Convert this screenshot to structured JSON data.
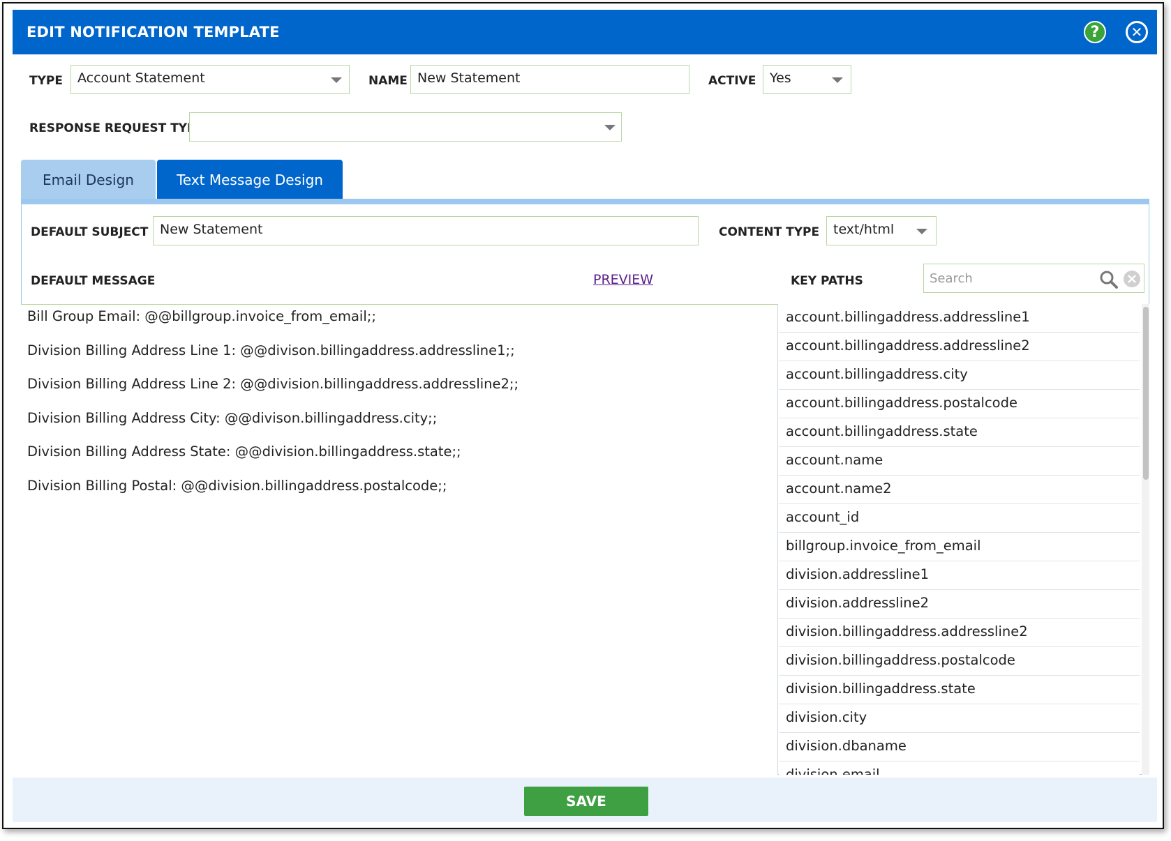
{
  "dialog": {
    "title": "EDIT NOTIFICATION TEMPLATE",
    "help_symbol": "?",
    "close_symbol": "✕"
  },
  "form": {
    "type_label": "TYPE",
    "type_value": "Account Statement",
    "name_label": "NAME",
    "name_value": "New Statement",
    "active_label": "ACTIVE",
    "active_value": "Yes",
    "response_request_type_label": "RESPONSE REQUEST TYPE",
    "response_request_type_value": ""
  },
  "tabs": [
    {
      "label": "Email Design"
    },
    {
      "label": "Text Message Design"
    }
  ],
  "email": {
    "default_subject_label": "DEFAULT SUBJECT",
    "default_subject_value": "New Statement",
    "content_type_label": "CONTENT TYPE",
    "content_type_value": "text/html",
    "default_message_label": "DEFAULT MESSAGE",
    "preview_label": "PREVIEW",
    "message_lines": [
      "Bill Group Email: @@billgroup.invoice_from_email;;",
      "Division Billing Address Line 1: @@divison.billingaddress.addressline1;;",
      "Division Billing Address Line 2: @@division.billingaddress.addressline2;;",
      "Division Billing Address City: @@divison.billingaddress.city;;",
      "Division Billing Address State: @@division.billingaddress.state;;",
      "Division Billing Postal: @@division.billingaddress.postalcode;;"
    ]
  },
  "key_paths": {
    "label": "KEY PATHS",
    "search_placeholder": "Search",
    "items": [
      "account.billingaddress.addressline1",
      "account.billingaddress.addressline2",
      "account.billingaddress.city",
      "account.billingaddress.postalcode",
      "account.billingaddress.state",
      "account.name",
      "account.name2",
      "account_id",
      "billgroup.invoice_from_email",
      "division.addressline1",
      "division.addressline2",
      "division.billingaddress.addressline2",
      "division.billingaddress.postalcode",
      "division.billingaddress.state",
      "division.city",
      "division.dbaname",
      "division.email"
    ]
  },
  "footer": {
    "save_label": "SAVE"
  },
  "colors": {
    "titlebar": "#0066cc",
    "save": "#3ea043",
    "help": "#3aa43a",
    "tab_active": "#0066cc",
    "tab_inactive": "#a9cdef"
  }
}
